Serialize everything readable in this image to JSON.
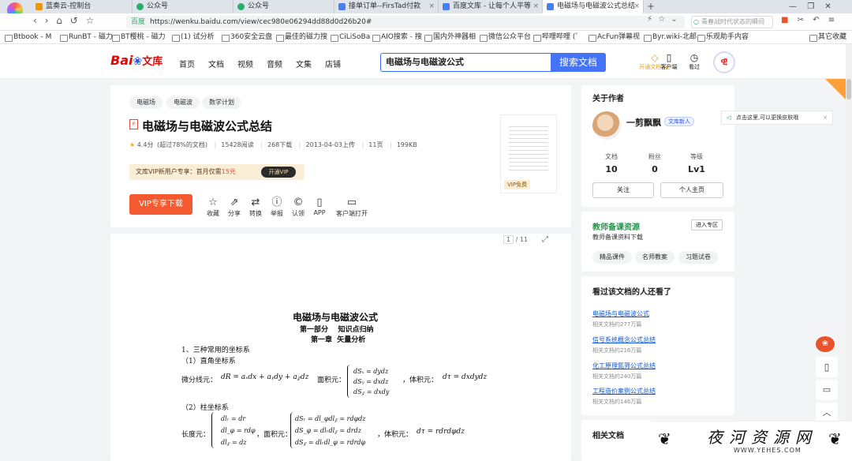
{
  "browser": {
    "tabs": [
      {
        "label": "蓝奏云-控制台",
        "color": "#f29300"
      },
      {
        "label": "公众号",
        "color": "#2aae67"
      },
      {
        "label": "公众号",
        "color": "#2aae67"
      },
      {
        "label": "接单订单--FirsTad付款",
        "color": "#4a7ef0"
      },
      {
        "label": "百度文库 - 让每个人平等",
        "color": "#4a7ef0"
      },
      {
        "label": "电磁场与电磁波公式总结",
        "color": "#4a7ef0"
      }
    ],
    "url": "https://wenku.baidu.com/view/cec980e06294dd88d0d26b20#",
    "url_tag": "百度",
    "right_search_placeholder": "青春战时代状态的瞬间",
    "bookmarks": [
      "Btbook - M",
      "RunBT - 磁力",
      "BT樱桃 - 磁力",
      "(1) 试分析",
      "360安全云盘",
      "最佳的磁力搜",
      "CiLiSoBa",
      "AIO搜索 - 搜",
      "国内外神器相",
      "微信公众平台",
      "哔哩哔哩 (゜",
      "AcFun弹幕视",
      "Byr.wiki-北邮",
      "乐观助手内容",
      "其它收藏"
    ]
  },
  "site": {
    "logo": "Bai",
    "logo_wenku": "文库",
    "nav": [
      "首页",
      "文档",
      "视频",
      "音频",
      "文集",
      "店铺"
    ],
    "search_value": "电磁场与电磁波公式",
    "search_button": "搜索文档",
    "header_right": [
      {
        "label": "开通文档2元",
        "icon": "diamond-icon"
      },
      {
        "label": "客户端",
        "icon": "phone-icon"
      },
      {
        "label": "看过",
        "icon": "clock-icon"
      }
    ]
  },
  "doc": {
    "tags": [
      "电磁场",
      "电磁波",
      "数学计划"
    ],
    "title": "电磁场与电磁波公式总结",
    "rating": "4.4分",
    "rating_note": "(超过78%的文档)",
    "reads": "15428阅读",
    "downloads": "268下载",
    "uploaded": "2013-04-03上传",
    "pages": "11页",
    "size": "199KB",
    "vip_promo": "文库VIP新用户专享：首月仅需",
    "vip_price": "15元",
    "vip_open": "开通VIP",
    "thumb_badge": "VIP免费",
    "vip_download": "VIP专享下载",
    "actions": [
      {
        "label": "收藏",
        "icon": "star-icon",
        "glyph": "☆"
      },
      {
        "label": "分享",
        "icon": "share-icon",
        "glyph": "⇗"
      },
      {
        "label": "转换",
        "icon": "convert-icon",
        "glyph": "⇄"
      },
      {
        "label": "举报",
        "icon": "report-icon",
        "glyph": "ⓘ"
      },
      {
        "label": "认领",
        "icon": "claim-icon",
        "glyph": "©"
      },
      {
        "label": "APP",
        "icon": "app-icon",
        "glyph": "▯"
      },
      {
        "label": "客户端打开",
        "icon": "client-icon",
        "glyph": "▭"
      }
    ],
    "page_current": "1",
    "page_total": "/ 11"
  },
  "content": {
    "heading": "电磁场与电磁波公式",
    "part": "第一部分    知识点归纳",
    "chapter": "第一章  矢量分析",
    "s1": "1、三种常用的坐标系",
    "s1a": "（1）直角坐标系",
    "line_label": "微分线元：",
    "line_expr": "dR = aₓdx + aᵧdy + a𝓏dz",
    "area_label": "面积元：",
    "area_list": [
      "dSₓ = dydz",
      "dSᵧ = dxdz",
      "dS𝓏 = dxdy"
    ],
    "vol_label": "，体积元：",
    "vol_expr": "dτ = dxdydz",
    "s1b": "（2）柱坐标系",
    "len_label": "长度元：",
    "len_list": [
      "dlᵣ = dr",
      "dl_φ = rdφ",
      "dl𝓏 = dz"
    ],
    "area2_label": "，面积元：",
    "area2_list": [
      "dSᵣ = dl_φdl𝓏 = rdφdz",
      "dS_φ = dlᵣdl𝓏 = drdz",
      "dS𝓏 = dlᵣdl_φ = rdrdφ"
    ],
    "vol2_label": "，体积元：",
    "vol2_expr": "dτ = rdrdφdz"
  },
  "author": {
    "section": "关于作者",
    "name": "一剪飘飘",
    "badge": "文库新人",
    "stats": [
      {
        "label": "文档",
        "value": "10"
      },
      {
        "label": "粉丝",
        "value": "0"
      },
      {
        "label": "等级",
        "value": "Lv1"
      }
    ],
    "follow": "关注",
    "profile": "个人主页"
  },
  "teacher": {
    "title": "教师备课资源",
    "sub": "教师备课资料下载",
    "enter": "进入专区",
    "chips": [
      "精品课件",
      "名师教案",
      "习题试卷"
    ]
  },
  "also": {
    "title": "看过该文档的人还看了",
    "items": [
      {
        "title": "电磁场与电磁波公式",
        "meta": "相关文档约277万篇"
      },
      {
        "title": "信号系统概念公式总结",
        "meta": "相关文档约216万篇"
      },
      {
        "title": "化工原理氮筛公式总结",
        "meta": "相关文档约240万篇"
      },
      {
        "title": "工程造价案例公式总结",
        "meta": "相关文档约146万篇"
      }
    ]
  },
  "related_title": "相关文档",
  "skin_tip": "点击这里,可以更换皮肤哦",
  "watermark": {
    "text": "夜河资源网",
    "url": "WWW.YEHES.COM"
  }
}
